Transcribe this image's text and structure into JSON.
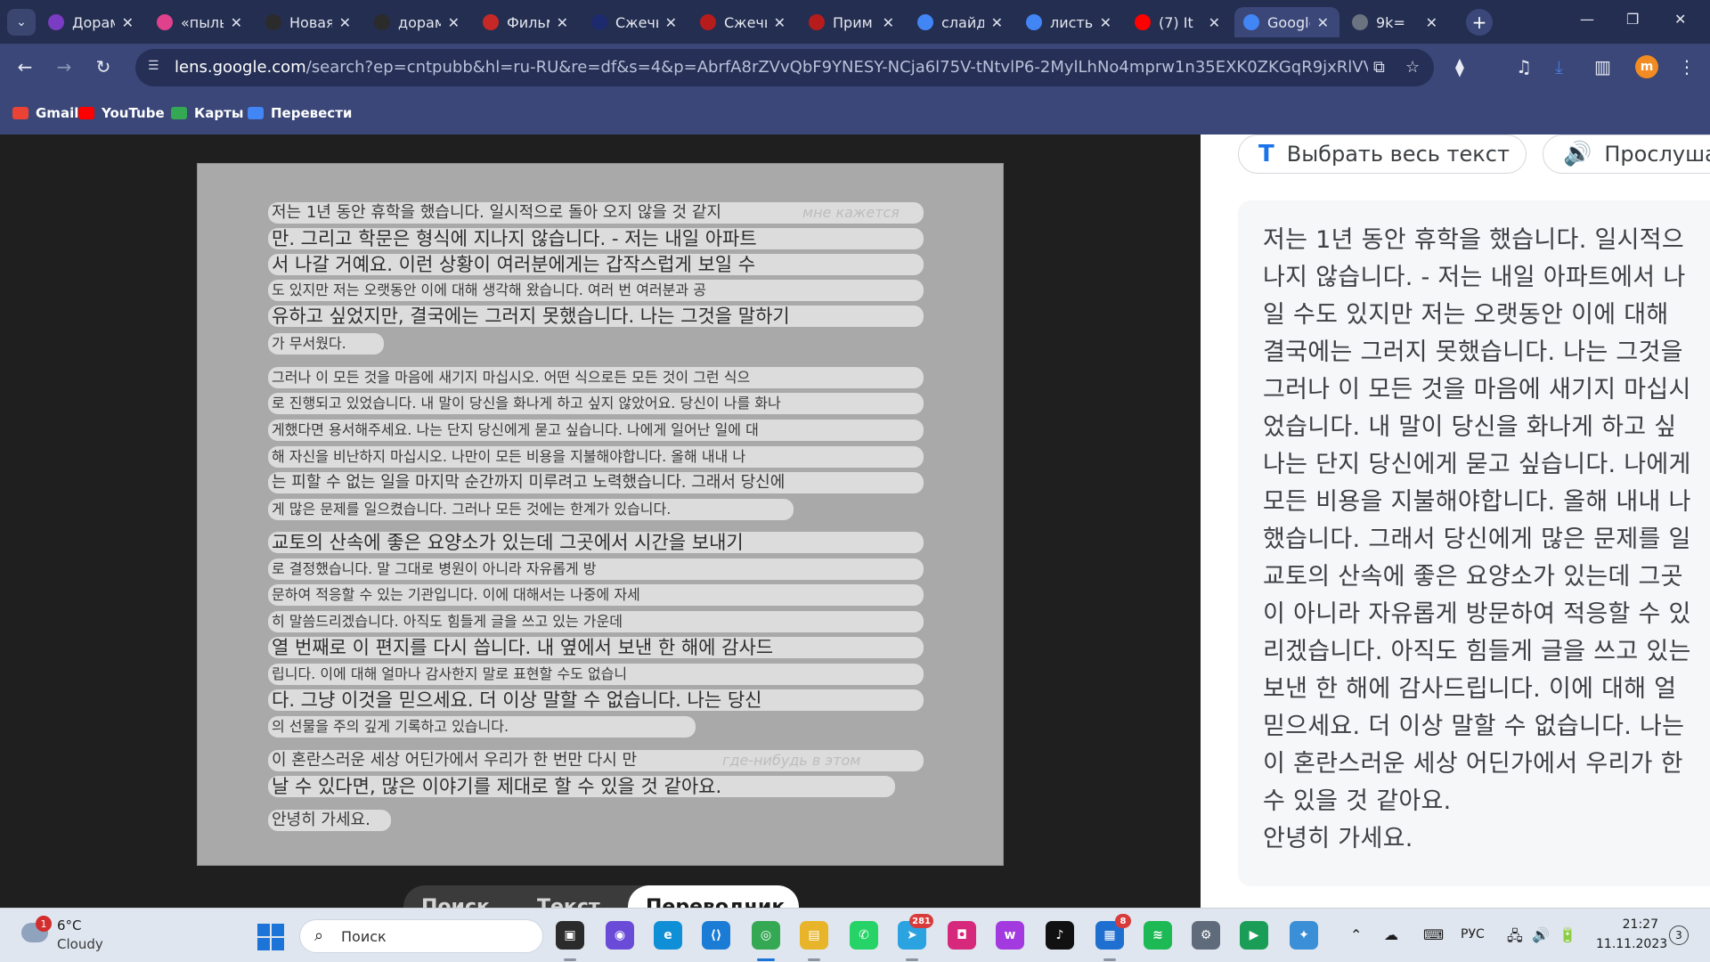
{
  "tabs": [
    {
      "title": "Дорама",
      "icon": "dorama-favicon-icon",
      "color": "#7a3cc2"
    },
    {
      "title": "«пыль",
      "icon": "play-favicon-icon",
      "color": "#e0418c"
    },
    {
      "title": "Новая",
      "icon": "chatgpt-favicon-icon",
      "color": "#2b2b2b"
    },
    {
      "title": "дорама",
      "icon": "chatgpt-favicon-icon",
      "color": "#2b2b2b"
    },
    {
      "title": "Фильм",
      "icon": "dl-favicon-icon",
      "color": "#c62828"
    },
    {
      "title": "Сжечь",
      "icon": "b-favicon-icon",
      "color": "#1e2a6e"
    },
    {
      "title": "Сжечь",
      "icon": "bag-favicon-icon",
      "color": "#b71c1c"
    },
    {
      "title": "Прим",
      "icon": "bag-favicon-icon",
      "color": "#b71c1c"
    },
    {
      "title": "слайд",
      "icon": "google-favicon-icon",
      "color": "#4285f4"
    },
    {
      "title": "листь",
      "icon": "google-favicon-icon",
      "color": "#4285f4"
    },
    {
      "title": "(7) It",
      "icon": "youtube-favicon-icon",
      "color": "#ff0000"
    },
    {
      "title": "Google",
      "icon": "google-lens-favicon-icon",
      "color": "#4285f4",
      "active": true
    },
    {
      "title": "9k=",
      "icon": "globe-favicon-icon",
      "color": "#6b7280"
    }
  ],
  "toolbar": {
    "url_host": "lens.google.com",
    "url_rest": "/search?ep=cntpubb&hl=ru-RU&re=df&s=4&p=AbrfA8rZVvQbF9YNESY-NCja6l75V-tNtvlP6-2MylLhNo4mprw1n35EXK0ZKGqR9jxRlVVm-Q_OfszRen1WJ...",
    "profile_letter": "m"
  },
  "bookmarks": [
    {
      "label": "Gmail",
      "icon": "gmail-icon",
      "color": "#ea4335"
    },
    {
      "label": "YouTube",
      "icon": "youtube-icon",
      "color": "#ff0000"
    },
    {
      "label": "Карты",
      "icon": "maps-icon",
      "color": "#34a853"
    },
    {
      "label": "Перевести",
      "icon": "translate-icon",
      "color": "#4285f4"
    }
  ],
  "document_lines": [
    {
      "text": "저는 1년 동안 휴학을 했습니다. 일시적으로 돌아 오지 않을 것 같지",
      "size": "normal"
    },
    {
      "text": "만. 그리고 학문은 형식에 지나지 않습니다. - 저는 내일 아파트",
      "size": "big"
    },
    {
      "text": "서 나갈 거예요. 이런 상황이 여러분에게는 갑작스럽게 보일 수",
      "size": "big"
    },
    {
      "text": "도 있지만 저는 오랫동안 이에 대해 생각해 왔습니다. 여러 번 여러분과 공",
      "size": "small"
    },
    {
      "text": "유하고 싶었지만, 결국에는 그러지 못했습니다. 나는 그것을 말하기",
      "size": "big"
    },
    {
      "text": "가 무서웠다.",
      "size": "small"
    },
    {
      "text": "그러나 이 모든 것을 마음에 새기지 마십시오. 어떤 식으로든 모든 것이 그런 식으",
      "size": "small"
    },
    {
      "text": "로 진행되고 있었습니다. 내 말이 당신을 화나게 하고 싶지 않았어요. 당신이 나를 화나",
      "size": "small"
    },
    {
      "text": "게했다면 용서해주세요. 나는 단지 당신에게 묻고 싶습니다. 나에게 일어난 일에 대",
      "size": "small"
    },
    {
      "text": "해 자신을 비난하지 마십시오. 나만이 모든 비용을 지불해야합니다. 올해 내내 나",
      "size": "small"
    },
    {
      "text": "는 피할 수 없는 일을 마지막 순간까지 미루려고 노력했습니다. 그래서 당신에",
      "size": "normal"
    },
    {
      "text": "게 많은 문제를 일으켰습니다. 그러나 모든 것에는 한계가 있습니다.",
      "size": "small"
    },
    {
      "text": "교토의 산속에 좋은 요양소가 있는데 그곳에서 시간을 보내기",
      "size": "big"
    },
    {
      "text": "로 결정했습니다. 말 그대로 병원이 아니라 자유롭게 방",
      "size": "small"
    },
    {
      "text": "문하여 적응할 수 있는 기관입니다. 이에 대해서는 나중에 자세",
      "size": "small"
    },
    {
      "text": "히 말씀드리겠습니다. 아직도 힘들게 글을 쓰고 있는 가운데",
      "size": "small"
    },
    {
      "text": "열 번째로 이 편지를 다시 씁니다. 내 옆에서 보낸 한 해에 감사드",
      "size": "big"
    },
    {
      "text": "립니다. 이에 대해 얼마나 감사한지 말로 표현할 수도 없습니",
      "size": "small"
    },
    {
      "text": "다. 그냥 이것을 믿으세요. 더 이상 말할 수 없습니다. 나는 당신",
      "size": "big"
    },
    {
      "text": "의 선물을 주의 깊게 기록하고 있습니다.",
      "size": "small"
    },
    {
      "text": "이 혼란스러운 세상 어딘가에서 우리가 한 번만 다시 만",
      "size": "normal"
    },
    {
      "text": "날 수 있다면, 많은 이야기를 제대로 할 수 있을 것 같아요.",
      "size": "big"
    },
    {
      "text": "안녕히 가세요.",
      "size": "normal"
    }
  ],
  "ghost_text": [
    "мне кажется",
    "где-нибудь в этом"
  ],
  "modes": [
    {
      "label": "Поиск",
      "active": false
    },
    {
      "label": "Текст",
      "active": false
    },
    {
      "label": "Переводчик",
      "active": true
    }
  ],
  "panel": {
    "select_all_label": "Выбрать весь текст",
    "listen_label": "Прослушать",
    "translated_lines": [
      "저는 1년 동안 휴학을 했습니다. 일시적으",
      "나지 않습니다. - 저는 내일 아파트에서 나",
      "일 수도 있지만 저는 오랫동안 이에 대해",
      "결국에는 그러지 못했습니다. 나는 그것을",
      "그러나 이 모든 것을 마음에 새기지 마십시",
      "었습니다. 내 말이 당신을 화나게 하고 싶",
      "나는 단지 당신에게 묻고 싶습니다. 나에게",
      "모든 비용을 지불해야합니다. 올해 내내 나",
      "했습니다. 그래서 당신에게 많은 문제를 일",
      "교토의 산속에 좋은 요양소가 있는데 그곳",
      "이 아니라 자유롭게 방문하여 적응할 수 있",
      "리겠습니다. 아직도 힘들게 글을 쓰고 있는",
      "보낸 한 해에 감사드립니다. 이에 대해 얼",
      "믿으세요. 더 이상 말할 수 없습니다. 나는",
      "이 혼란스러운 세상 어딘가에서 우리가 한",
      "수 있을 것 같아요.",
      "안녕히 가세요."
    ]
  },
  "taskbar": {
    "weather_temp": "6°C",
    "weather_cond": "Cloudy",
    "weather_badge": "1",
    "search_placeholder": "Поиск",
    "apps": [
      {
        "name": "task-view-icon",
        "color": "#2b2b2b",
        "glyph": "▣"
      },
      {
        "name": "meet-icon",
        "color": "#6a4bd8",
        "glyph": "◉"
      },
      {
        "name": "edge-icon",
        "color": "#0f8fd6",
        "glyph": "e"
      },
      {
        "name": "vscode-icon",
        "color": "#1b7cd6",
        "glyph": "⟨⟩"
      },
      {
        "name": "chrome-icon",
        "color": "#34a853",
        "glyph": "◎",
        "active": true
      },
      {
        "name": "file-explorer-icon",
        "color": "#e8b429",
        "glyph": "▤"
      },
      {
        "name": "whatsapp-icon",
        "color": "#25d366",
        "glyph": "✆"
      },
      {
        "name": "telegram-icon",
        "color": "#2aa3e0",
        "glyph": "➤",
        "badge": "281"
      },
      {
        "name": "instagram-icon",
        "color": "#d6297b",
        "glyph": "◘"
      },
      {
        "name": "wink-icon",
        "color": "#a23ae0",
        "glyph": "w"
      },
      {
        "name": "tiktok-icon",
        "color": "#111111",
        "glyph": "♪"
      },
      {
        "name": "store-icon",
        "color": "#1f6fd1",
        "glyph": "▦",
        "badge": "8"
      },
      {
        "name": "spotify-icon",
        "color": "#1db954",
        "glyph": "≋"
      },
      {
        "name": "settings-icon",
        "color": "#5f6b7a",
        "glyph": "⚙"
      },
      {
        "name": "play-store-icon",
        "color": "#1a9e57",
        "glyph": "▶"
      },
      {
        "name": "game-icon",
        "color": "#3a8fd6",
        "glyph": "✦"
      }
    ],
    "tray_lang": "РУС",
    "time": "21:27",
    "date": "11.11.2023",
    "notif_count": "3"
  }
}
